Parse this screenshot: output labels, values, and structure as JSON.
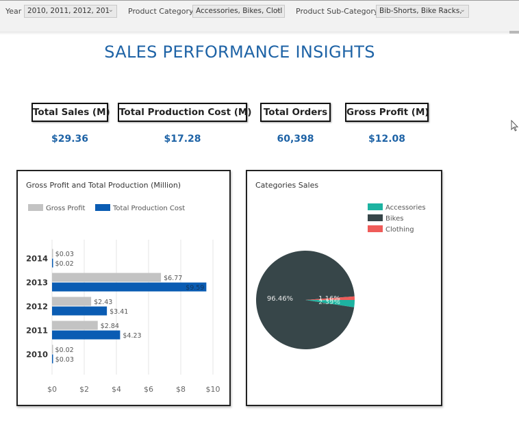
{
  "filters": [
    {
      "label": "Year",
      "value": "2010, 2011, 2012, 201"
    },
    {
      "label": "Product Category",
      "value": "Accessories, Bikes, Clotl"
    },
    {
      "label": "Product Sub-Category",
      "value": "Bib-Shorts, Bike Racks,"
    }
  ],
  "page_title": "SALES PERFORMANCE INSIGHTS",
  "kpis": [
    {
      "label": "Total Sales (M)",
      "value": "$29.36"
    },
    {
      "label": "Total Production Cost (M)",
      "value": "$17.28"
    },
    {
      "label": "Total Orders",
      "value": "60,398"
    },
    {
      "label": "Gross Profit (M)",
      "value": "$12.08"
    }
  ],
  "colors": {
    "accent": "#1e63a6",
    "gross_profit": "#c3c3c3",
    "production_cost": "#0a5cb3",
    "accessories": "#1db3a1",
    "bikes": "#374649",
    "clothing": "#ef5c59"
  },
  "chart_data": [
    {
      "type": "bar",
      "orientation": "horizontal",
      "title": "Gross Profit and Total Production (Million)",
      "categories": [
        "2014",
        "2013",
        "2012",
        "2011",
        "2010"
      ],
      "series": [
        {
          "name": "Gross Profit",
          "values": [
            0.03,
            6.77,
            2.43,
            2.84,
            0.02
          ],
          "labels": [
            "$0.03",
            "$6.77",
            "$2.43",
            "$2.84",
            "$0.02"
          ]
        },
        {
          "name": "Total Production Cost",
          "values": [
            0.02,
            9.59,
            3.41,
            4.23,
            0.03
          ],
          "labels": [
            "$0.02",
            "$9.59",
            "$3.41",
            "$4.23",
            "$0.03"
          ]
        }
      ],
      "xticks": [
        "$0",
        "$2",
        "$4",
        "$6",
        "$8",
        "$10"
      ],
      "xtick_values": [
        0,
        2,
        4,
        6,
        8,
        10
      ],
      "xlim": [
        0,
        10
      ],
      "xlabel": "",
      "ylabel": "",
      "grid": true,
      "legend": "top-left"
    },
    {
      "type": "pie",
      "title": "Categories Sales",
      "slices": [
        {
          "name": "Accessories",
          "value": 2.39,
          "label": "2.39%"
        },
        {
          "name": "Bikes",
          "value": 96.46,
          "label": "96.46%"
        },
        {
          "name": "Clothing",
          "value": 1.16,
          "label": "1.16%"
        }
      ],
      "legend": "top-right"
    }
  ]
}
